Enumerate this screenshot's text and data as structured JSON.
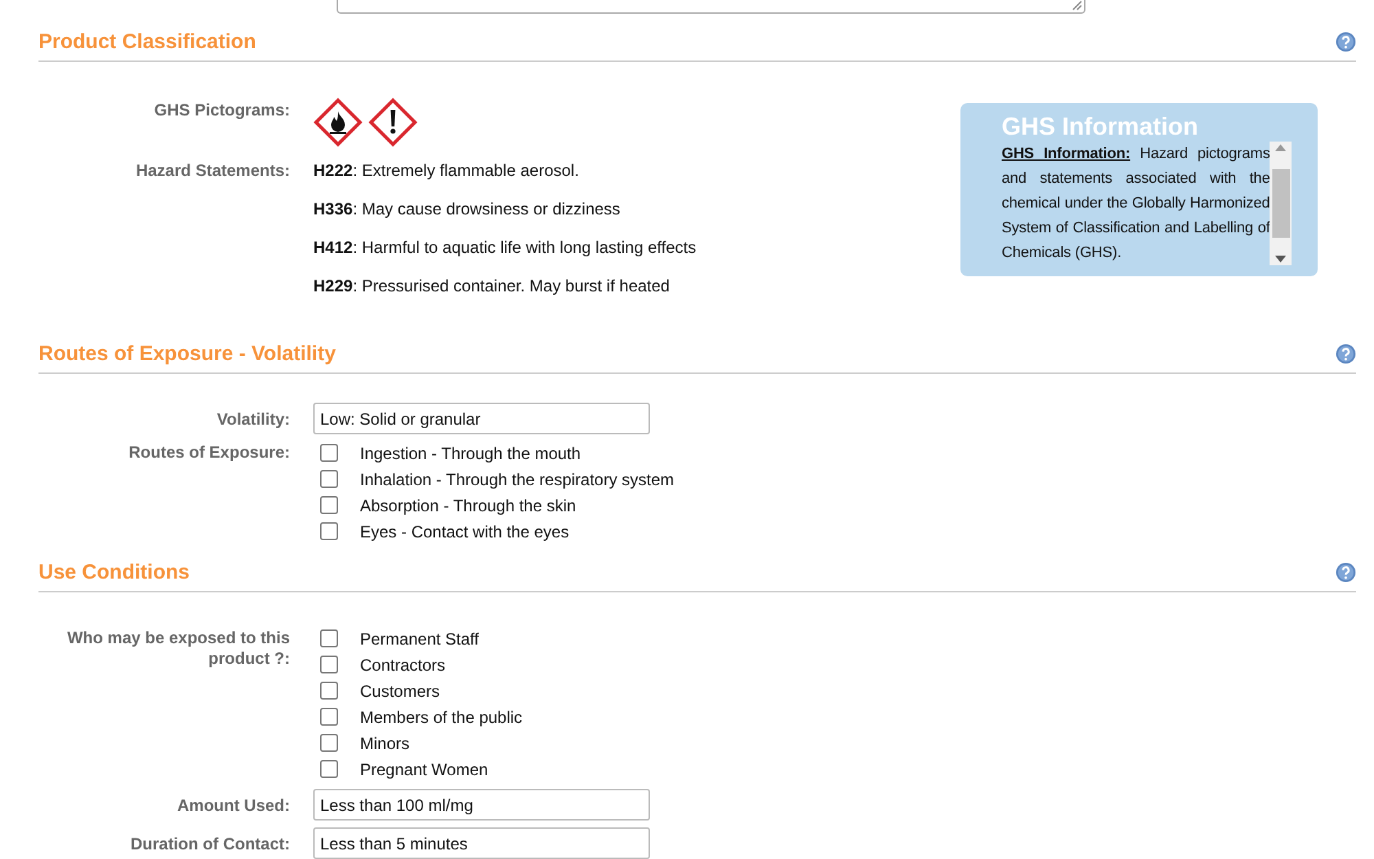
{
  "sections": [
    {
      "title": "Product Classification",
      "kind": "classification",
      "pictograms_label": "GHS Pictograms:",
      "pictograms": [
        {
          "kind": "flame"
        },
        {
          "kind": "exclamation"
        }
      ],
      "statements_label": "Hazard Statements:",
      "statements": [
        "**H222**: Extremely flammable aerosol.",
        "**H336**: May cause drowsiness or dizziness",
        "**H412**: Harmful to aquatic life with long lasting effects",
        "**H229**: Pressurised container. May burst if heated"
      ],
      "info": {
        "title": "GHS Information",
        "lead": "GHS Information:",
        "text": " Hazard pictograms and statements associated with the chemical under the Globally Harmonized System of Classification and Labelling of Chemicals (GHS)."
      }
    },
    {
      "title": "Routes of Exposure - Volatility",
      "kind": "form",
      "fields": [
        {
          "kind": "text",
          "label": "Volatility:",
          "value": "Low: Solid or granular"
        },
        {
          "kind": "checklist",
          "label": "Routes of Exposure:",
          "options": [
            {
              "label": "Ingestion - Through the mouth",
              "checked": false
            },
            {
              "label": "Inhalation - Through the respiratory system",
              "checked": false
            },
            {
              "label": "Absorption - Through the skin",
              "checked": false
            },
            {
              "label": "Eyes - Contact with the eyes",
              "checked": false
            }
          ]
        }
      ]
    },
    {
      "title": "Use Conditions",
      "kind": "form",
      "fields": [
        {
          "kind": "checklist",
          "label": "Who may be exposed to this product ?:",
          "options": [
            {
              "label": "Permanent Staff",
              "checked": false
            },
            {
              "label": "Contractors",
              "checked": false
            },
            {
              "label": "Customers",
              "checked": false
            },
            {
              "label": "Members of the public",
              "checked": false
            },
            {
              "label": "Minors",
              "checked": false
            },
            {
              "label": "Pregnant Women",
              "checked": false
            }
          ]
        },
        {
          "kind": "text",
          "label": "Amount Used:",
          "value": "Less than 100 ml/mg"
        },
        {
          "kind": "text",
          "label": "Duration of Contact:",
          "value": "Less than 5 minutes"
        }
      ]
    }
  ]
}
